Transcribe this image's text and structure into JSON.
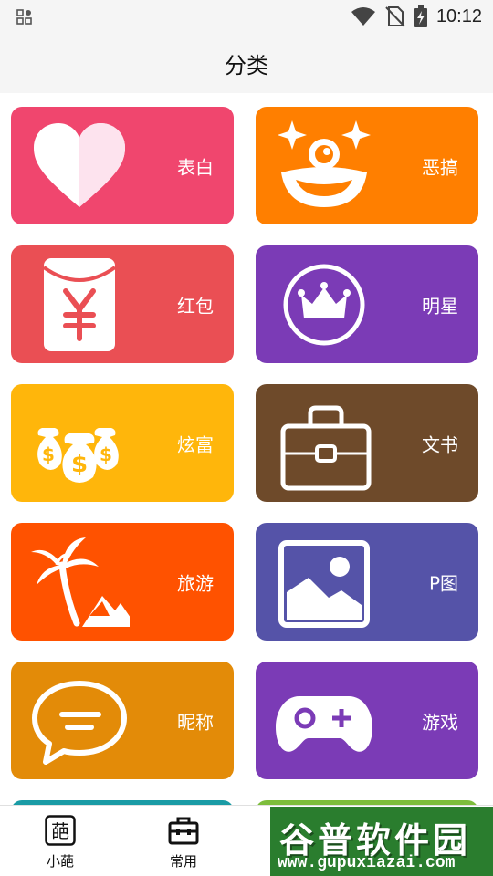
{
  "status_bar": {
    "time": "10:12"
  },
  "header": {
    "title": "分类"
  },
  "categories": [
    {
      "label": "表白",
      "color": "#f0466e",
      "icon": "heart-icon"
    },
    {
      "label": "恶搞",
      "color": "#ff7f00",
      "icon": "clown-face-icon"
    },
    {
      "label": "红包",
      "color": "#ea4f54",
      "icon": "red-envelope-icon"
    },
    {
      "label": "明星",
      "color": "#7b3bb6",
      "icon": "crown-icon"
    },
    {
      "label": "炫富",
      "color": "#ffb60b",
      "icon": "money-bags-icon"
    },
    {
      "label": "文书",
      "color": "#6e4a2a",
      "icon": "briefcase-icon"
    },
    {
      "label": "旅游",
      "color": "#ff5200",
      "icon": "palm-tree-icon"
    },
    {
      "label": "P图",
      "color": "#5553a8",
      "icon": "picture-icon"
    },
    {
      "label": "昵称",
      "color": "#e38b08",
      "icon": "chat-bubble-icon"
    },
    {
      "label": "游戏",
      "color": "#7b3bb6",
      "icon": "gamepad-icon"
    }
  ],
  "bottom_nav": [
    {
      "label": "小葩",
      "icon": "pa-logo-icon"
    },
    {
      "label": "常用",
      "icon": "toolbox-icon"
    }
  ],
  "watermark": {
    "title": "谷普软件园",
    "url": "www.gupuxiazai.com"
  }
}
